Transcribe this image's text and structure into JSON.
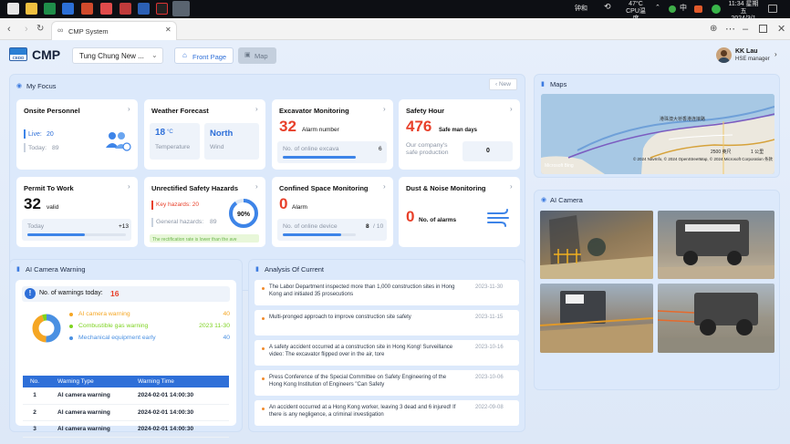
{
  "taskbar": {
    "tray_left_text": "钟和",
    "weather_temp": "47°C",
    "weather_desc": "CPU温度",
    "ime_label": "中",
    "time": "11:34 星期五",
    "date": "2024/3/1"
  },
  "browser": {
    "tab_title": "CMP System"
  },
  "header": {
    "app_name": "CMP",
    "site_select": "Tung Chung New ...",
    "front_page_label": "Front Page",
    "map_label": "Map",
    "user_name": "KK Lau",
    "user_role": "HSE manager"
  },
  "focus": {
    "title": "My Focus",
    "new_label": "New",
    "onsite": {
      "title": "Onsite Personnel",
      "live_label": "Live:",
      "live_value": "20",
      "today_label": "Today:",
      "today_value": "89"
    },
    "weather": {
      "title": "Weather Forecast",
      "temp_value": "18",
      "temp_unit": "°C",
      "temp_label": "Temperature",
      "wind_value": "North",
      "wind_label": "Wind"
    },
    "excavator": {
      "title": "Excavator Monitoring",
      "alarm_value": "32",
      "alarm_label": "Alarm number",
      "online_label": "No. of online excava",
      "online_value": "6",
      "progress": 1.0
    },
    "safety": {
      "title": "Safety Hour",
      "value": "476",
      "unit": "Safe man days",
      "record_label": "Our company's safe production",
      "record_value": "0"
    },
    "permit": {
      "title": "Permit To Work",
      "value": "32",
      "unit": "valid",
      "today_label": "Today",
      "today_value": "+13",
      "progress": 0.58
    },
    "hazards": {
      "title": "Unrectified Safety Hazards",
      "key_label": "Key hazards: 20",
      "general_label": "General hazards:",
      "general_value": "89",
      "percent_label": "90%",
      "percent": 0.9,
      "note": "The rectification rate is lower than the ave"
    },
    "confined": {
      "title": "Confined Space Monitoring",
      "value": "0",
      "unit": "Alarm",
      "online_label": "No. of online device",
      "online_value": "8",
      "online_total": "/ 10",
      "progress": 0.8
    },
    "dust": {
      "title": "Dust & Noise Monitoring",
      "value": "0",
      "unit": "No. of alarms"
    }
  },
  "maps": {
    "title": "Maps",
    "scale_a": "2500 英尺",
    "scale_b": "1 公里",
    "attribution": "© 2024 NavInfo, © 2024 OpenStreetMap, © 2024 Microsoft Corporation 条款",
    "label_road": "港珠澳大桥香港连接路",
    "brand": "Microsoft Bing"
  },
  "camera": {
    "title": "AI Camera"
  },
  "warning": {
    "title": "AI Camera Warning",
    "count_label": "No. of warnings today:",
    "count_value": "16",
    "legend": [
      {
        "label": "AI camera warning",
        "value": "40",
        "color": "#f5a623"
      },
      {
        "label": "Combustible gas warning",
        "value": "2023  11-30",
        "color": "#7ed321"
      },
      {
        "label": "Mechanical equipment early",
        "value": "40",
        "color": "#4a90e2"
      }
    ],
    "table": {
      "headers": [
        "No.",
        "Warning Type",
        "Warning Time"
      ],
      "rows": [
        [
          "1",
          "AI camera warning",
          "2024-02-01 14:00:30"
        ],
        [
          "2",
          "AI camera warning",
          "2024-02-01 14:00:30"
        ],
        [
          "3",
          "AI camera warning",
          "2024-02-01 14:00:30"
        ]
      ]
    }
  },
  "analysis": {
    "title": "Analysis Of Current",
    "items": [
      {
        "text": "The Labor Department inspected more than 1,000 construction sites in Hong Kong and initiated 35 prosecutions",
        "date": "2023-11-30"
      },
      {
        "text": "Multi-pronged approach to improve construction site safety",
        "date": "2023-11-15"
      },
      {
        "text": "A safety accident occurred at a construction site in Hong Kong! Surveillance video: The excavator flipped over in the air, tore",
        "date": "2023-10-16"
      },
      {
        "text": "Press Conference of the Special Committee on Safety Engineering of the Hong Kong Institution of Engineers \"Can Safety",
        "date": "2023-10-06"
      },
      {
        "text": "An accident occurred at a Hong Kong worker, leaving 3 dead and 6 injured! If there is any negligence, a criminal investigation",
        "date": "2022-09-08"
      }
    ]
  }
}
